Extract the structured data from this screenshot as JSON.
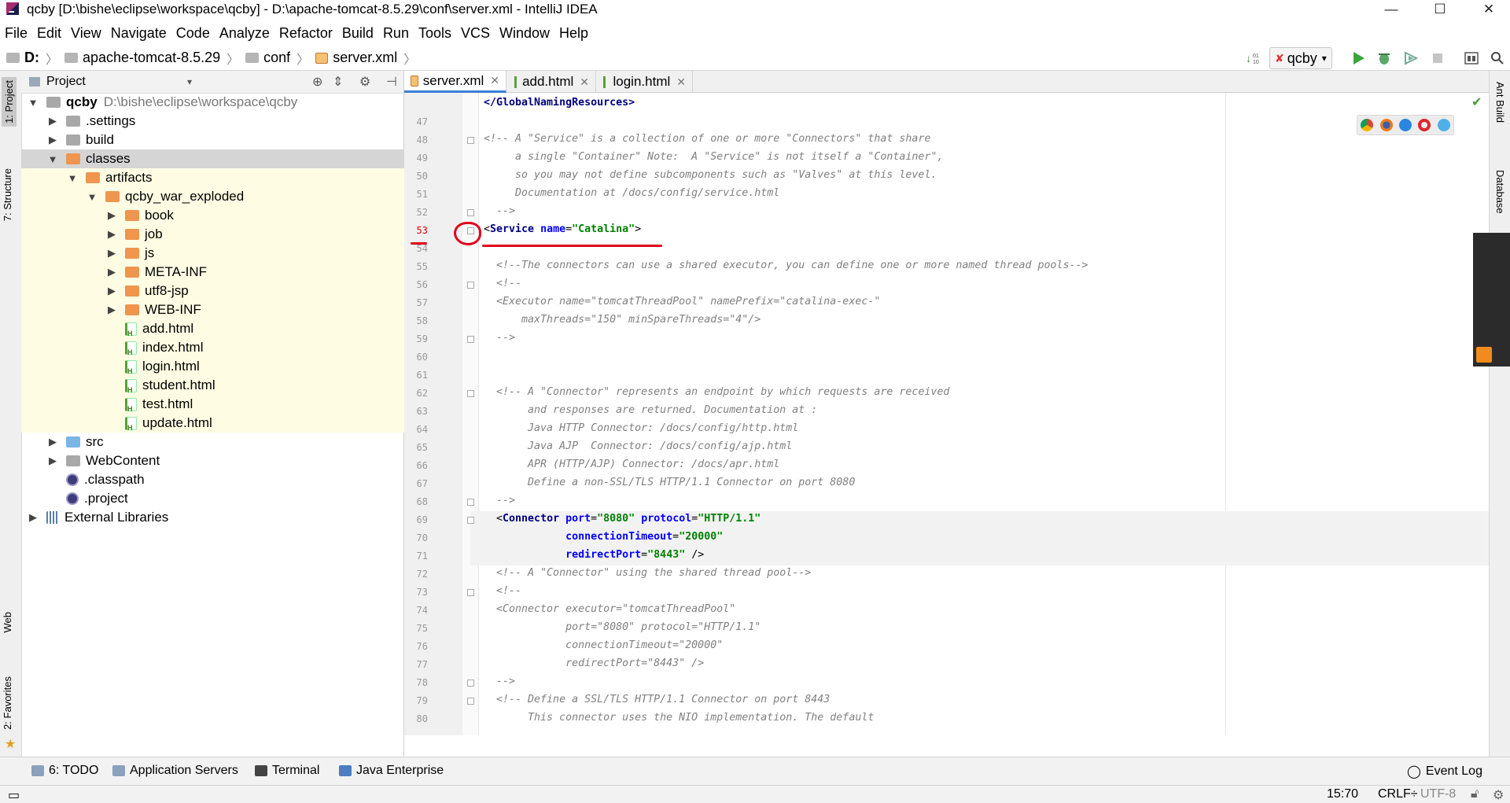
{
  "window": {
    "title": "qcby [D:\\bishe\\eclipse\\workspace\\qcby] - D:\\apache-tomcat-8.5.29\\conf\\server.xml - IntelliJ IDEA",
    "minimize": "—",
    "maximize": "☐",
    "close": "✕"
  },
  "menu": [
    "File",
    "Edit",
    "View",
    "Navigate",
    "Code",
    "Analyze",
    "Refactor",
    "Build",
    "Run",
    "Tools",
    "VCS",
    "Window",
    "Help"
  ],
  "breadcrumb": [
    "D:",
    "apache-tomcat-8.5.29",
    "conf",
    "server.xml"
  ],
  "run_config": "qcby",
  "left_tabs": [
    "1: Project",
    "7: Structure",
    "Web",
    "2: Favorites"
  ],
  "right_tabs": [
    "Ant Build",
    "Database"
  ],
  "project_panel": {
    "title": "Project",
    "tree": [
      {
        "label": "qcby",
        "extra": "D:\\bishe\\eclipse\\workspace\\qcby",
        "indent": 0,
        "arrow": "down",
        "icon": "folder"
      },
      {
        "label": ".settings",
        "indent": 1,
        "arrow": "right",
        "icon": "folder"
      },
      {
        "label": "build",
        "indent": 1,
        "arrow": "right",
        "icon": "folder"
      },
      {
        "label": "classes",
        "indent": 1,
        "arrow": "down",
        "icon": "folder-orange",
        "selected": true
      },
      {
        "label": "artifacts",
        "indent": 2,
        "arrow": "down",
        "icon": "folder-orange",
        "yellow": true
      },
      {
        "label": "qcby_war_exploded",
        "indent": 3,
        "arrow": "down",
        "icon": "folder-orange",
        "yellow": true
      },
      {
        "label": "book",
        "indent": 4,
        "arrow": "right",
        "icon": "folder-orange",
        "yellow": true
      },
      {
        "label": "job",
        "indent": 4,
        "arrow": "right",
        "icon": "folder-orange",
        "yellow": true
      },
      {
        "label": "js",
        "indent": 4,
        "arrow": "right",
        "icon": "folder-orange",
        "yellow": true
      },
      {
        "label": "META-INF",
        "indent": 4,
        "arrow": "right",
        "icon": "folder-orange",
        "yellow": true
      },
      {
        "label": "utf8-jsp",
        "indent": 4,
        "arrow": "right",
        "icon": "folder-orange",
        "yellow": true
      },
      {
        "label": "WEB-INF",
        "indent": 4,
        "arrow": "right",
        "icon": "folder-orange",
        "yellow": true
      },
      {
        "label": "add.html",
        "indent": 4,
        "arrow": "",
        "icon": "html",
        "yellow": true
      },
      {
        "label": "index.html",
        "indent": 4,
        "arrow": "",
        "icon": "html",
        "yellow": true
      },
      {
        "label": "login.html",
        "indent": 4,
        "arrow": "",
        "icon": "html",
        "yellow": true
      },
      {
        "label": "student.html",
        "indent": 4,
        "arrow": "",
        "icon": "html",
        "yellow": true
      },
      {
        "label": "test.html",
        "indent": 4,
        "arrow": "",
        "icon": "html",
        "yellow": true
      },
      {
        "label": "update.html",
        "indent": 4,
        "arrow": "",
        "icon": "html",
        "yellow": true
      },
      {
        "label": "src",
        "indent": 1,
        "arrow": "right",
        "icon": "folder-blue"
      },
      {
        "label": "WebContent",
        "indent": 1,
        "arrow": "right",
        "icon": "folder"
      },
      {
        "label": ".classpath",
        "indent": 1,
        "arrow": "",
        "icon": "eclipse"
      },
      {
        "label": ".project",
        "indent": 1,
        "arrow": "",
        "icon": "eclipse"
      },
      {
        "label": "External Libraries",
        "indent": 0,
        "arrow": "right",
        "icon": "lib"
      }
    ]
  },
  "editor_tabs": [
    {
      "label": "server.xml",
      "type": "xml",
      "active": true
    },
    {
      "label": "add.html",
      "type": "html"
    },
    {
      "label": "login.html",
      "type": "html"
    }
  ],
  "code_lines": [
    {
      "n": "",
      "parts": [
        [
          "tag",
          "</GlobalNamingResources>"
        ]
      ]
    },
    {
      "n": "47",
      "parts": []
    },
    {
      "n": "48",
      "parts": [
        [
          "cmt",
          "<!-- A \"Service\" is a collection of one or more \"Connectors\" that share"
        ]
      ]
    },
    {
      "n": "49",
      "parts": [
        [
          "cmt",
          "     a single \"Container\" Note:  A \"Service\" is not itself a \"Container\","
        ]
      ]
    },
    {
      "n": "50",
      "parts": [
        [
          "cmt",
          "     so you may not define subcomponents such as \"Valves\" at this level."
        ]
      ]
    },
    {
      "n": "51",
      "parts": [
        [
          "cmt",
          "     Documentation at /docs/config/service.html"
        ]
      ]
    },
    {
      "n": "52",
      "parts": [
        [
          "cmt",
          "  -->"
        ]
      ]
    },
    {
      "n": "53",
      "parts": [
        [
          "plain",
          "<"
        ],
        [
          "tag",
          "Service "
        ],
        [
          "attr",
          "name"
        ],
        [
          "plain",
          "="
        ],
        [
          "val",
          "\"Catalina\""
        ],
        [
          "plain",
          ">"
        ]
      ]
    },
    {
      "n": "54",
      "parts": []
    },
    {
      "n": "55",
      "parts": [
        [
          "cmt",
          "  <!--The connectors can use a shared executor, you can define one or more named thread pools-->"
        ]
      ]
    },
    {
      "n": "56",
      "parts": [
        [
          "cmt",
          "  <!--"
        ]
      ]
    },
    {
      "n": "57",
      "parts": [
        [
          "cmt",
          "  <Executor name=\"tomcatThreadPool\" namePrefix=\"catalina-exec-\""
        ]
      ]
    },
    {
      "n": "58",
      "parts": [
        [
          "cmt",
          "      maxThreads=\"150\" minSpareThreads=\"4\"/>"
        ]
      ]
    },
    {
      "n": "59",
      "parts": [
        [
          "cmt",
          "  -->"
        ]
      ]
    },
    {
      "n": "60",
      "parts": []
    },
    {
      "n": "61",
      "parts": []
    },
    {
      "n": "62",
      "parts": [
        [
          "cmt",
          "  <!-- A \"Connector\" represents an endpoint by which requests are received"
        ]
      ]
    },
    {
      "n": "63",
      "parts": [
        [
          "cmt",
          "       and responses are returned. Documentation at :"
        ]
      ]
    },
    {
      "n": "64",
      "parts": [
        [
          "cmt",
          "       Java HTTP Connector: /docs/config/http.html"
        ]
      ]
    },
    {
      "n": "65",
      "parts": [
        [
          "cmt",
          "       Java AJP  Connector: /docs/config/ajp.html"
        ]
      ]
    },
    {
      "n": "66",
      "parts": [
        [
          "cmt",
          "       APR (HTTP/AJP) Connector: /docs/apr.html"
        ]
      ]
    },
    {
      "n": "67",
      "parts": [
        [
          "cmt",
          "       Define a non-SSL/TLS HTTP/1.1 Connector on port 8080"
        ]
      ]
    },
    {
      "n": "68",
      "parts": [
        [
          "cmt",
          "  -->"
        ]
      ]
    },
    {
      "n": "69",
      "parts": [
        [
          "plain",
          "  <"
        ],
        [
          "tag",
          "Connector "
        ],
        [
          "attr",
          "port"
        ],
        [
          "plain",
          "="
        ],
        [
          "val",
          "\"8080\" "
        ],
        [
          "attr",
          "protocol"
        ],
        [
          "plain",
          "="
        ],
        [
          "val",
          "\"HTTP/1.1\""
        ]
      ]
    },
    {
      "n": "70",
      "parts": [
        [
          "plain",
          "             "
        ],
        [
          "attr",
          "connectionTimeout"
        ],
        [
          "plain",
          "="
        ],
        [
          "val",
          "\"20000\""
        ]
      ]
    },
    {
      "n": "71",
      "parts": [
        [
          "plain",
          "             "
        ],
        [
          "attr",
          "redirectPort"
        ],
        [
          "plain",
          "="
        ],
        [
          "val",
          "\"8443\" "
        ],
        [
          "plain",
          "/>"
        ]
      ]
    },
    {
      "n": "72",
      "parts": [
        [
          "cmt",
          "  <!-- A \"Connector\" using the shared thread pool-->"
        ]
      ]
    },
    {
      "n": "73",
      "parts": [
        [
          "cmt",
          "  <!--"
        ]
      ]
    },
    {
      "n": "74",
      "parts": [
        [
          "cmt",
          "  <Connector executor=\"tomcatThreadPool\""
        ]
      ]
    },
    {
      "n": "75",
      "parts": [
        [
          "cmt",
          "             port=\"8080\" protocol=\"HTTP/1.1\""
        ]
      ]
    },
    {
      "n": "76",
      "parts": [
        [
          "cmt",
          "             connectionTimeout=\"20000\""
        ]
      ]
    },
    {
      "n": "77",
      "parts": [
        [
          "cmt",
          "             redirectPort=\"8443\" />"
        ]
      ]
    },
    {
      "n": "78",
      "parts": [
        [
          "cmt",
          "  -->"
        ]
      ]
    },
    {
      "n": "79",
      "parts": [
        [
          "cmt",
          "  <!-- Define a SSL/TLS HTTP/1.1 Connector on port 8443"
        ]
      ]
    },
    {
      "n": "80",
      "parts": [
        [
          "cmt",
          "       This connector uses the NIO implementation. The default"
        ]
      ]
    }
  ],
  "bottom_tabs": [
    "6: TODO",
    "Application Servers",
    "Terminal",
    "Java Enterprise"
  ],
  "event_log": "Event Log",
  "status": {
    "position": "15:70",
    "line_sep": "CRLF÷",
    "encoding": "UTF-8"
  }
}
